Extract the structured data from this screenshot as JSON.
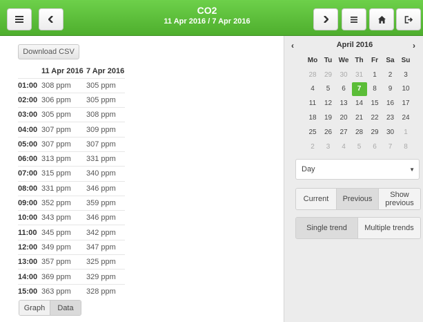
{
  "header": {
    "title": "CO2",
    "subtitle": "11 Apr 2016 / 7 Apr 2016",
    "icons": [
      "menu-icon",
      "chevron-left-icon",
      "chevron-right-icon",
      "list-icon",
      "home-icon",
      "logout-icon"
    ]
  },
  "toolbar": {
    "download_label": "Download CSV"
  },
  "table": {
    "columns": [
      "",
      "11 Apr 2016",
      "7 Apr 2016"
    ],
    "rows": [
      [
        "01:00",
        "308 ppm",
        "305 ppm"
      ],
      [
        "02:00",
        "306 ppm",
        "305 ppm"
      ],
      [
        "03:00",
        "305 ppm",
        "308 ppm"
      ],
      [
        "04:00",
        "307 ppm",
        "309 ppm"
      ],
      [
        "05:00",
        "307 ppm",
        "307 ppm"
      ],
      [
        "06:00",
        "313 ppm",
        "331 ppm"
      ],
      [
        "07:00",
        "315 ppm",
        "340 ppm"
      ],
      [
        "08:00",
        "331 ppm",
        "346 ppm"
      ],
      [
        "09:00",
        "352 ppm",
        "359 ppm"
      ],
      [
        "10:00",
        "343 ppm",
        "346 ppm"
      ],
      [
        "11:00",
        "345 ppm",
        "342 ppm"
      ],
      [
        "12:00",
        "349 ppm",
        "347 ppm"
      ],
      [
        "13:00",
        "357 ppm",
        "325 ppm"
      ],
      [
        "14:00",
        "369 ppm",
        "329 ppm"
      ],
      [
        "15:00",
        "363 ppm",
        "328 ppm"
      ]
    ]
  },
  "view_tabs": {
    "graph": "Graph",
    "data": "Data",
    "active": "data"
  },
  "calendar": {
    "prev": "‹",
    "next": "›",
    "title": "April 2016",
    "weekdays": [
      "Mo",
      "Tu",
      "We",
      "Th",
      "Fr",
      "Sa",
      "Su"
    ],
    "weeks": [
      [
        "28",
        "29",
        "30",
        "31",
        "1",
        "2",
        "3"
      ],
      [
        "4",
        "5",
        "6",
        "7",
        "8",
        "9",
        "10"
      ],
      [
        "11",
        "12",
        "13",
        "14",
        "15",
        "16",
        "17"
      ],
      [
        "18",
        "19",
        "20",
        "21",
        "22",
        "23",
        "24"
      ],
      [
        "25",
        "26",
        "27",
        "28",
        "29",
        "30",
        "1"
      ],
      [
        "2",
        "3",
        "4",
        "5",
        "6",
        "7",
        "8"
      ]
    ],
    "selected_day": "7",
    "selected_color": "#5bbd38"
  },
  "period_select": {
    "value": "Day"
  },
  "compare_buttons": {
    "current": "Current",
    "previous": "Previous",
    "show_previous": "Show previous",
    "active": "previous"
  },
  "trend_buttons": {
    "single": "Single trend",
    "multiple": "Multiple trends",
    "active": "single"
  },
  "colors": {
    "header_green": "#5bbd38",
    "panel_gray": "#ececec"
  }
}
